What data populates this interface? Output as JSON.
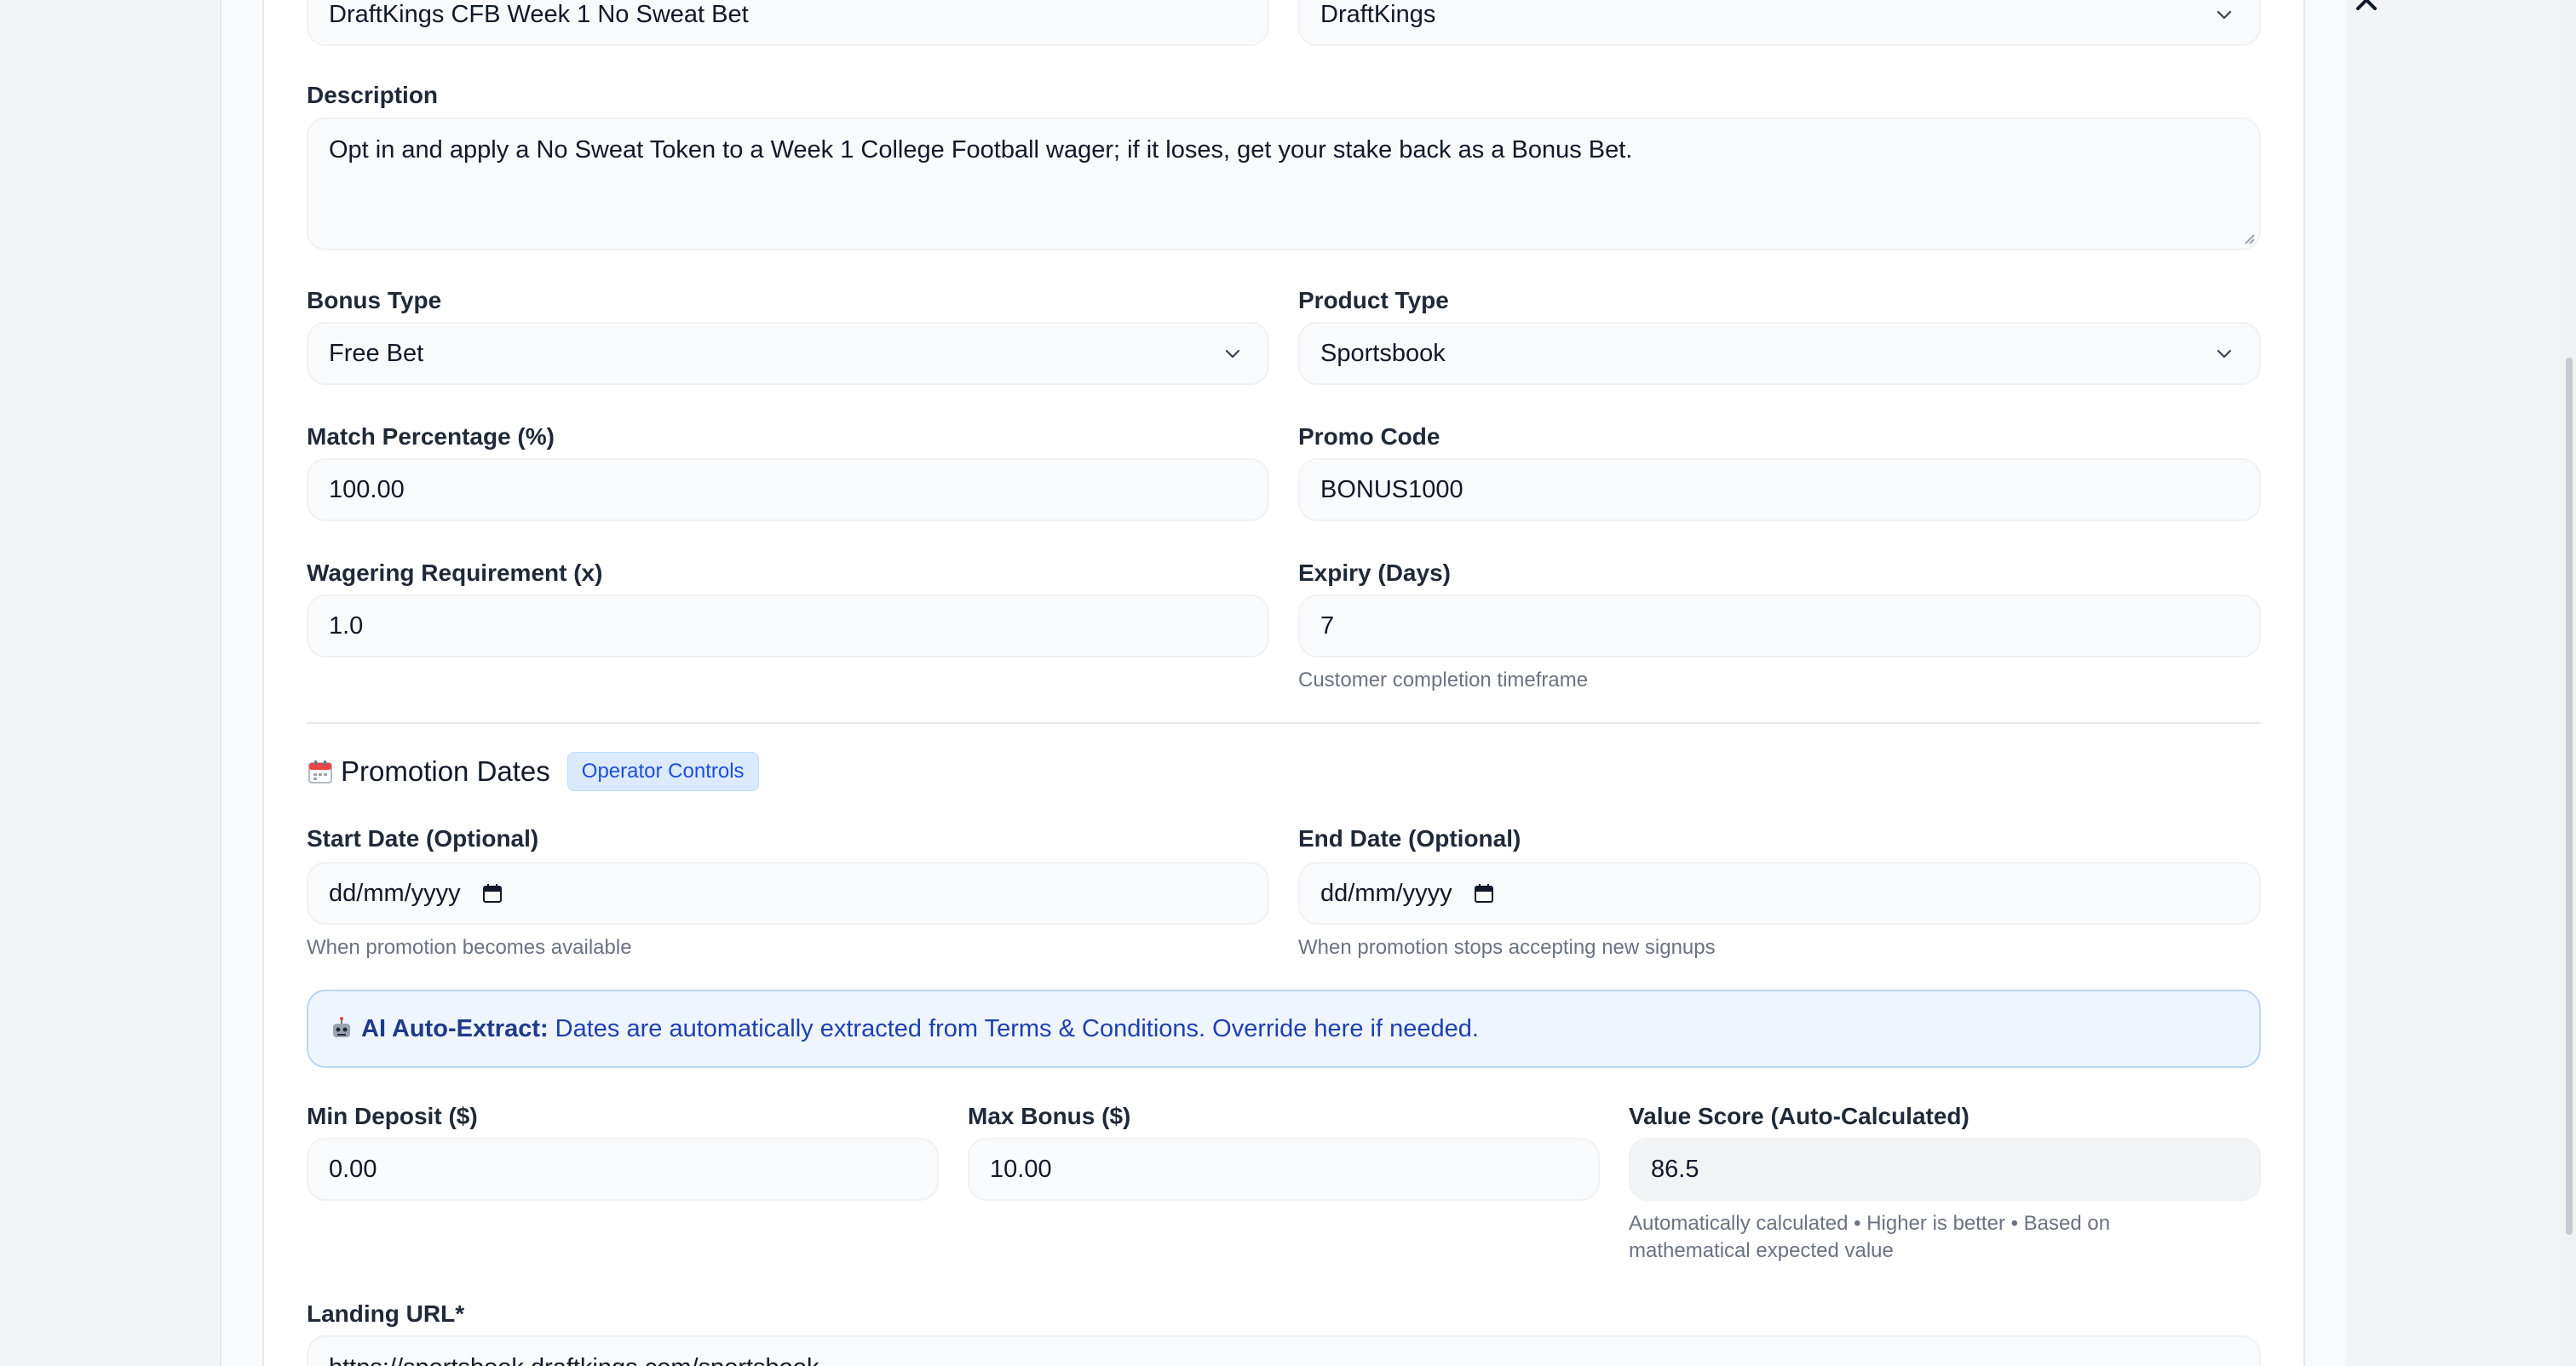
{
  "top_row": {
    "name_value": "DraftKings CFB Week 1 No Sweat Bet",
    "operator_value": "DraftKings"
  },
  "description": {
    "label": "Description",
    "value": "Opt in and apply a No Sweat Token to a Week 1 College Football wager; if it loses, get your stake back as a Bonus Bet."
  },
  "bonus_type": {
    "label": "Bonus Type",
    "value": "Free Bet"
  },
  "product_type": {
    "label": "Product Type",
    "value": "Sportsbook"
  },
  "match_percentage": {
    "label": "Match Percentage (%)",
    "value": "100.00"
  },
  "promo_code": {
    "label": "Promo Code",
    "value": "BONUS1000"
  },
  "wagering": {
    "label": "Wagering Requirement (x)",
    "value": "1.0"
  },
  "expiry": {
    "label": "Expiry (Days)",
    "value": "7",
    "hint": "Customer completion timeframe"
  },
  "promotion_dates": {
    "title": "Promotion Dates",
    "badge": "Operator Controls",
    "start": {
      "label": "Start Date (Optional)",
      "placeholder": "dd/mm/yyyy",
      "hint": "When promotion becomes available"
    },
    "end": {
      "label": "End Date (Optional)",
      "placeholder": "dd/mm/yyyy",
      "hint": "When promotion stops accepting new signups"
    }
  },
  "ai_banner": {
    "strong": "AI Auto-Extract:",
    "text": "Dates are automatically extracted from Terms & Conditions. Override here if needed."
  },
  "min_deposit": {
    "label": "Min Deposit ($)",
    "value": "0.00"
  },
  "max_bonus": {
    "label": "Max Bonus ($)",
    "value": "10.00"
  },
  "value_score": {
    "label": "Value Score (Auto-Calculated)",
    "value": "86.5",
    "hint_line1": "Automatically calculated • Higher is better • Based on",
    "hint_line2": "mathematical expected value"
  },
  "landing_url": {
    "label": "Landing URL*",
    "value": "https://sportsbook.draftkings.com/sportsbook"
  },
  "colors": {
    "accent": "#1d4ed8",
    "banner_bg": "#eef5ff",
    "badge_bg": "#dbeafe"
  }
}
